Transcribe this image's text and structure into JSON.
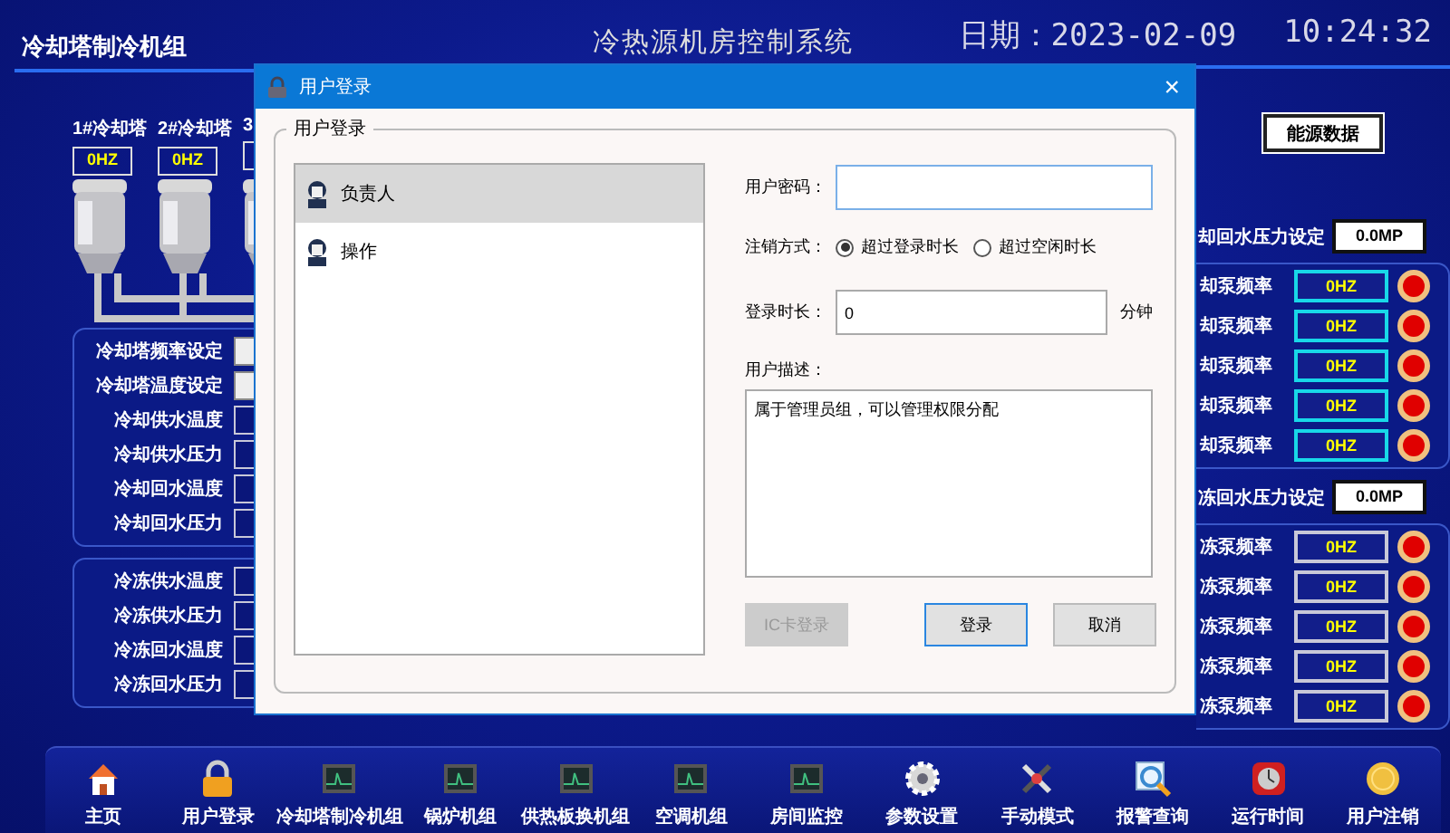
{
  "header": {
    "section_title": "冷却塔制冷机组",
    "system_title": "冷热源机房控制系统",
    "date": "日期：2023-02-09",
    "time": "10:24:32"
  },
  "towers": [
    {
      "label": "1#冷却塔",
      "value": "0HZ"
    },
    {
      "label": "2#冷却塔",
      "value": "0HZ"
    },
    {
      "label": "3"
    }
  ],
  "cooling_panel": [
    {
      "label": "冷却塔频率设定",
      "kind": "setpoint"
    },
    {
      "label": "冷却塔温度设定",
      "kind": "setpoint"
    },
    {
      "label": "冷却供水温度",
      "kind": "reading"
    },
    {
      "label": "冷却供水压力",
      "kind": "reading"
    },
    {
      "label": "冷却回水温度",
      "kind": "reading"
    },
    {
      "label": "冷却回水压力",
      "kind": "reading"
    }
  ],
  "chilled_panel": [
    {
      "label": "冷冻供水温度",
      "kind": "reading"
    },
    {
      "label": "冷冻供水压力",
      "kind": "reading"
    },
    {
      "label": "冷冻回水温度",
      "kind": "reading"
    },
    {
      "label": "冷冻回水压力",
      "kind": "reading"
    }
  ],
  "energy_button": "能源数据",
  "cooling_pressure": {
    "label": "却回水压力设定",
    "value": "0.0MP"
  },
  "cooling_pumps": [
    {
      "label": "却泵频率",
      "value": "0HZ",
      "running": false
    },
    {
      "label": "却泵频率",
      "value": "0HZ",
      "running": false
    },
    {
      "label": "却泵频率",
      "value": "0HZ",
      "running": false
    },
    {
      "label": "却泵频率",
      "value": "0HZ",
      "running": false
    },
    {
      "label": "却泵频率",
      "value": "0HZ",
      "running": false
    }
  ],
  "chilled_pressure": {
    "label": "冻回水压力设定",
    "value": "0.0MP"
  },
  "chilled_pumps": [
    {
      "label": "冻泵频率",
      "value": "0HZ",
      "running": false
    },
    {
      "label": "冻泵频率",
      "value": "0HZ",
      "running": false
    },
    {
      "label": "冻泵频率",
      "value": "0HZ",
      "running": false
    },
    {
      "label": "冻泵频率",
      "value": "0HZ",
      "running": false
    },
    {
      "label": "冻泵频率",
      "value": "0HZ",
      "running": false
    }
  ],
  "nav": [
    {
      "label": "主页",
      "kind": "home"
    },
    {
      "label": "用户登录",
      "kind": "lock"
    },
    {
      "label": "冷却塔制冷机组",
      "kind": "monitor"
    },
    {
      "label": "锅炉机组",
      "kind": "monitor"
    },
    {
      "label": "供热板换机组",
      "kind": "monitor"
    },
    {
      "label": "空调机组",
      "kind": "monitor"
    },
    {
      "label": "房间监控",
      "kind": "monitor"
    },
    {
      "label": "参数设置",
      "kind": "gear"
    },
    {
      "label": "手动模式",
      "kind": "tools"
    },
    {
      "label": "报警查询",
      "kind": "magnifier"
    },
    {
      "label": "运行时间",
      "kind": "clock"
    },
    {
      "label": "用户注销",
      "kind": "coin"
    }
  ],
  "dialog": {
    "title": "用户登录",
    "close": "×",
    "group_title": "用户登录",
    "users": [
      {
        "name": "负责人",
        "selected": true
      },
      {
        "name": "操作",
        "selected": false
      }
    ],
    "password": {
      "label": "用户密码：",
      "focused": true
    },
    "logout_mode": {
      "label": "注销方式：",
      "options": [
        {
          "label": "超过登录时长",
          "selected": true
        },
        {
          "label": "超过空闲时长",
          "selected": false
        }
      ]
    },
    "duration": {
      "label": "登录时长：",
      "value": "0",
      "unit": "分钟"
    },
    "description": {
      "label": "用户描述：",
      "value": "属于管理员组，可以管理权限分配"
    },
    "buttons": [
      {
        "label": "IC卡登录",
        "disabled": true,
        "default": false
      },
      {
        "label": "登录",
        "disabled": false,
        "default": true
      },
      {
        "label": "取消",
        "disabled": false,
        "default": false
      }
    ]
  }
}
